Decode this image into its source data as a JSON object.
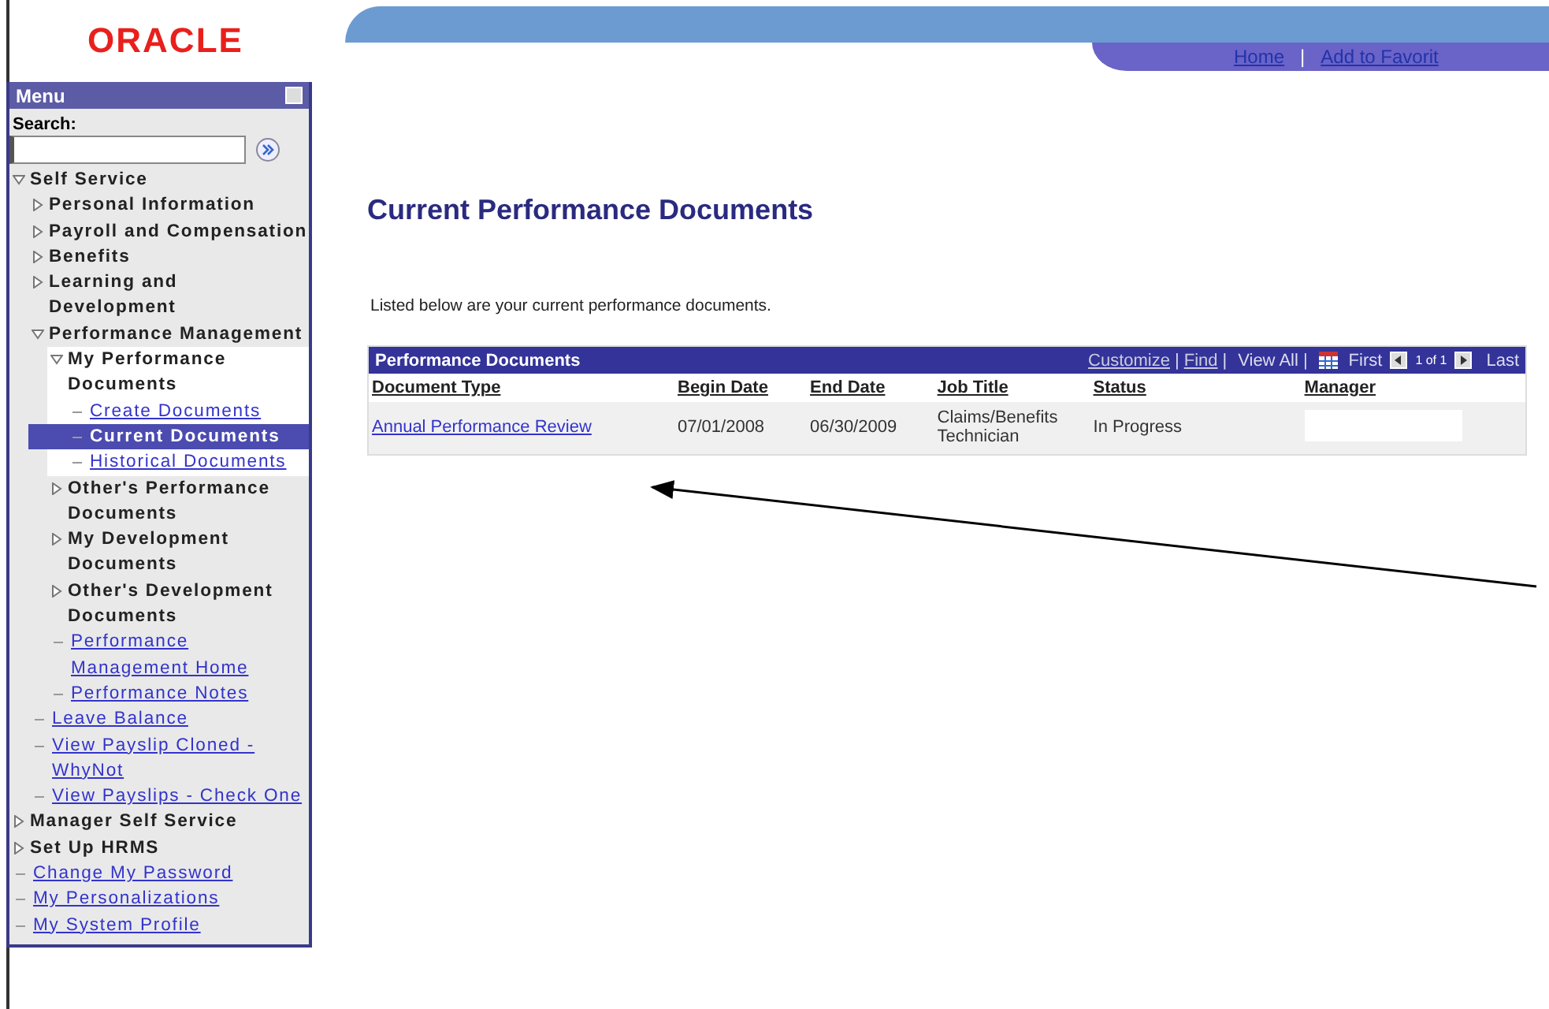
{
  "logo": "ORACLE",
  "header_links": [
    {
      "kind": "link",
      "text": "Home"
    },
    {
      "kind": "sep",
      "text": "|"
    },
    {
      "kind": "link",
      "text": "Add to Favorit"
    }
  ],
  "menu": {
    "title": "Menu",
    "search_label": "Search:",
    "items": [
      {
        "kind": "folder",
        "text": "Self Service",
        "expanded": true,
        "children": [
          {
            "kind": "folder",
            "text": "Personal Information",
            "expanded": false
          },
          {
            "kind": "folder",
            "text": "Payroll and Compensation",
            "expanded": false
          },
          {
            "kind": "folder",
            "text": "Benefits",
            "expanded": false
          },
          {
            "kind": "folder",
            "text": "Learning and Development",
            "expanded": false
          },
          {
            "kind": "folder",
            "text": "Performance Management",
            "expanded": true,
            "children": [
              {
                "kind": "folder",
                "text": "My Performance Documents",
                "expanded": true,
                "children": [
                  {
                    "kind": "link",
                    "text": "Create Documents",
                    "selected": false
                  },
                  {
                    "kind": "link",
                    "text": "Current Documents",
                    "selected": true
                  },
                  {
                    "kind": "link",
                    "text": "Historical Documents",
                    "selected": false
                  }
                ]
              },
              {
                "kind": "folder",
                "text": "Other's Performance Documents",
                "expanded": false
              },
              {
                "kind": "folder",
                "text": "My Development Documents",
                "expanded": false
              },
              {
                "kind": "folder",
                "text": "Other's Development Documents",
                "expanded": false
              },
              {
                "kind": "link",
                "text": "Performance Management Home",
                "selected": false
              },
              {
                "kind": "link",
                "text": "Performance Notes",
                "selected": false
              }
            ]
          },
          {
            "kind": "link",
            "text": "Leave Balance",
            "selected": false
          },
          {
            "kind": "link",
            "text": "View Payslip Cloned - WhyNot",
            "selected": false
          },
          {
            "kind": "link",
            "text": "View Payslips - Check One",
            "selected": false
          }
        ]
      },
      {
        "kind": "folder",
        "text": "Manager Self Service",
        "expanded": false
      },
      {
        "kind": "folder",
        "text": "Set Up HRMS",
        "expanded": false
      },
      {
        "kind": "link",
        "text": "Change My Password",
        "selected": false
      },
      {
        "kind": "link",
        "text": "My Personalizations",
        "selected": false
      },
      {
        "kind": "link",
        "text": "My System Profile",
        "selected": false
      }
    ]
  },
  "page_title": "Current Performance Documents",
  "intro": "Listed below are your current performance documents.",
  "grid": {
    "title": "Performance Documents",
    "tools": [
      {
        "kind": "link",
        "text": "Customize"
      },
      {
        "kind": "sep",
        "text": "|"
      },
      {
        "kind": "link",
        "text": "Find"
      },
      {
        "kind": "sep",
        "text": "|"
      },
      {
        "kind": "text",
        "text": "View All"
      },
      {
        "kind": "sep",
        "text": "|"
      },
      {
        "kind": "grid-icon"
      },
      {
        "kind": "text",
        "text": "First"
      },
      {
        "kind": "prev"
      },
      {
        "kind": "small",
        "text": "1 of 1"
      },
      {
        "kind": "next"
      },
      {
        "kind": "text",
        "text": "Last"
      }
    ],
    "columns": [
      "Document Type",
      "Begin Date",
      "End Date",
      "Job Title",
      "Status",
      "Manager"
    ],
    "rows": [
      {
        "document_type": "Annual Performance Review",
        "begin_date": "07/01/2008",
        "end_date": "06/30/2009",
        "job_title": "Claims/Benefits Technician",
        "status": "In Progress",
        "manager_redacted": true
      }
    ]
  }
}
